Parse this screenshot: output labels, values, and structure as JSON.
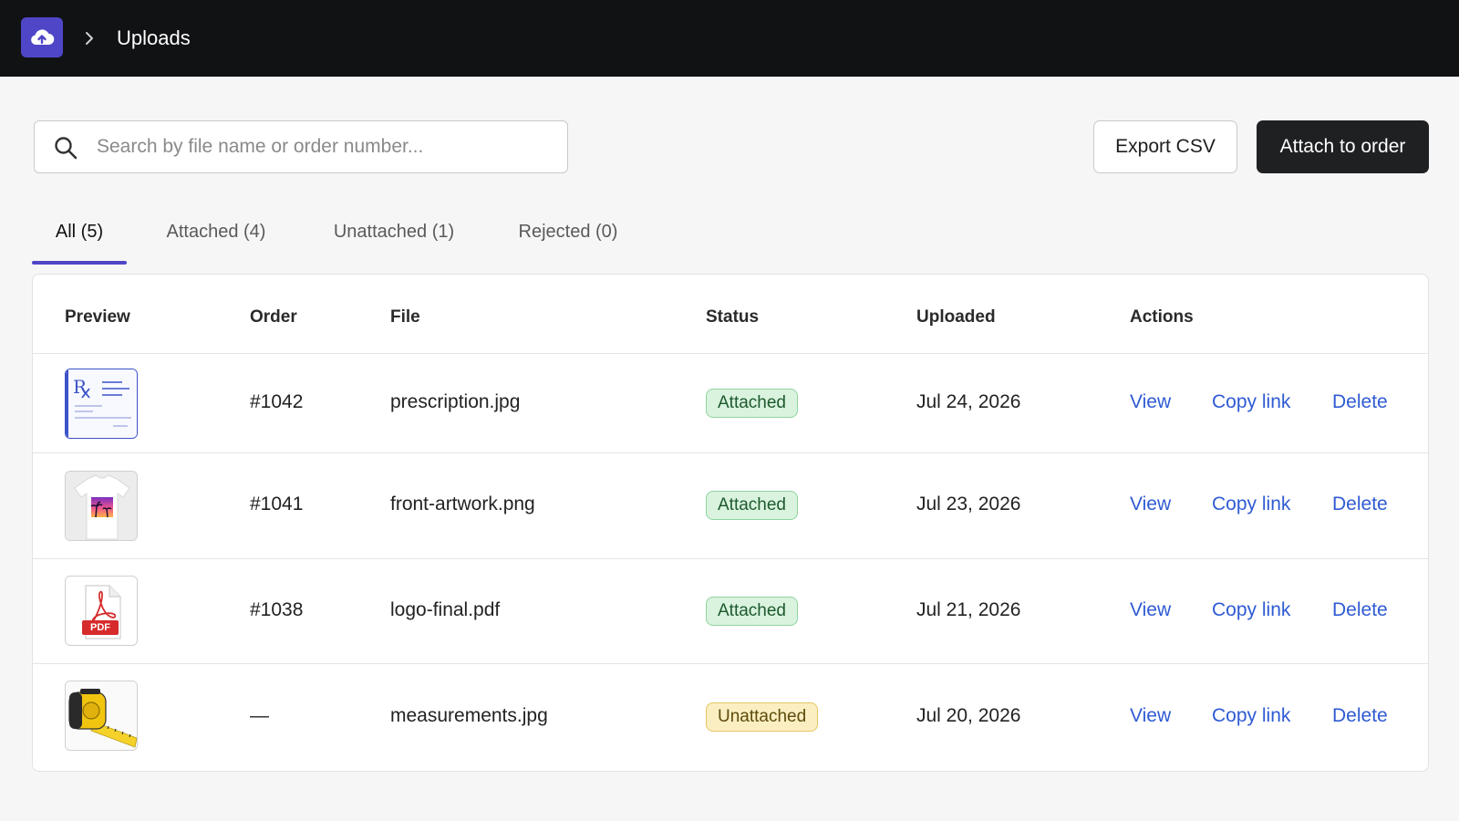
{
  "header": {
    "breadcrumb_title": "Uploads",
    "logo_icon": "cloud-upload-icon",
    "chevron_icon": "chevron-right-icon"
  },
  "toolbar": {
    "search_placeholder": "Search by file name or order number...",
    "search_value": "",
    "export_label": "Export CSV",
    "attach_label": "Attach to order"
  },
  "tabs": [
    {
      "label": "All  (5)",
      "active": true
    },
    {
      "label": "Attached (4)",
      "active": false
    },
    {
      "label": "Unattached (1)",
      "active": false
    },
    {
      "label": "Rejected (0)",
      "active": false
    }
  ],
  "table": {
    "columns": {
      "preview": "Preview",
      "order": "Order",
      "file": "File",
      "status": "Status",
      "uploaded": "Uploaded",
      "actions": "Actions"
    },
    "action_labels": {
      "view": "View",
      "copy": "Copy link",
      "delete": "Delete"
    },
    "rows": [
      {
        "preview": "prescription-thumbnail",
        "order": "#1042",
        "file": "prescription.jpg",
        "status": "Attached",
        "uploaded": "Jul 24, 2026"
      },
      {
        "preview": "tshirt-artwork-thumbnail",
        "order": "#1041",
        "file": "front-artwork.png",
        "status": "Attached",
        "uploaded": "Jul 23, 2026"
      },
      {
        "preview": "pdf-thumbnail",
        "pdf_label": "PDF",
        "order": "#1038",
        "file": "logo-final.pdf",
        "status": "Attached",
        "uploaded": "Jul 21, 2026"
      },
      {
        "preview": "tape-measure-thumbnail",
        "order": "—",
        "file": "measurements.jpg",
        "status": "Unattached",
        "uploaded": "Jul 20, 2026"
      }
    ]
  },
  "colors": {
    "brand": "#4f46c7",
    "topbar": "#111214",
    "link": "#2f5bd3",
    "attached_bg": "#d9f3df",
    "unattached_bg": "#fbefc2"
  }
}
